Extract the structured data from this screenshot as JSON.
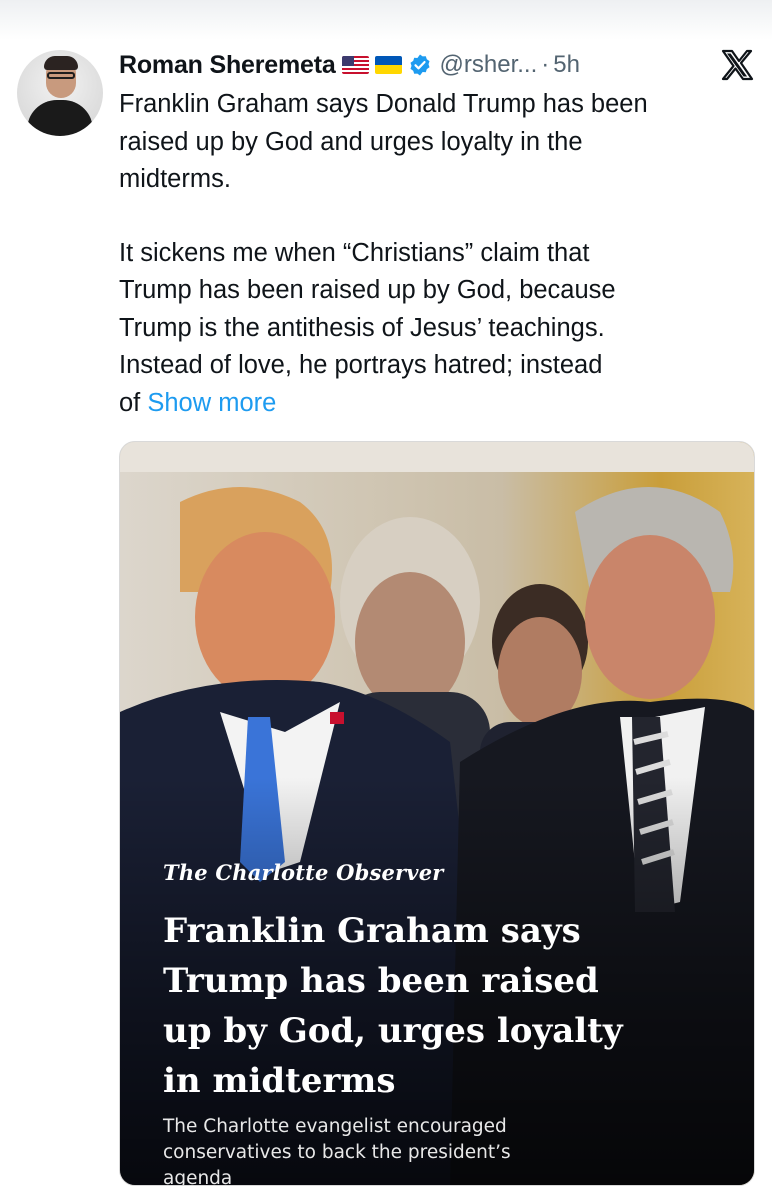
{
  "tweet": {
    "author_name": "Roman Sheremeta",
    "handle": "@rsher...",
    "separator": "·",
    "time": "5h",
    "line1": "Franklin Graham says Donald Trump has been\nraised up by God and urges loyalty in the\nmidterms.",
    "line2": "It sickens me when “Christians” claim that\nTrump has been raised up by God, because\nTrump is the antithesis of Jesus’ teachings.\nInstead of love, he portrays hatred; instead\nof ",
    "show_more": "Show more"
  },
  "icons": {
    "flags": [
      "us-flag-icon",
      "ukraine-flag-icon"
    ],
    "verified": "verified-badge-icon",
    "platform": "x-logo-icon"
  },
  "card": {
    "masthead": "The Charlotte Observer",
    "headline": "Franklin Graham says\nTrump has been raised\nup by God, urges loyalty\nin midterms",
    "subhead": "The Charlotte evangelist encouraged\nconservatives to back the president’s agenda"
  },
  "colors": {
    "link": "#1d9bf0",
    "verified": "#1d9bf0",
    "text": "#0f1419",
    "muted": "#536471"
  }
}
